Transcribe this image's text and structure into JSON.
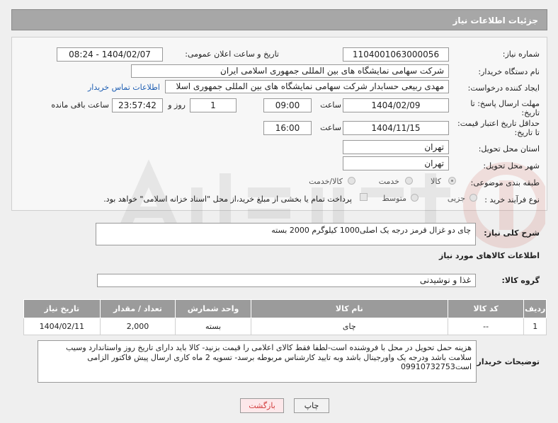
{
  "header": {
    "title": "جزئیات اطلاعات نیاز"
  },
  "form": {
    "need_number_label": "شماره نیاز:",
    "need_number": "1104001063000056",
    "announce_label": "تاریخ و ساعت اعلان عمومی:",
    "announce_value": "1404/02/07 - 08:24",
    "buyer_org_label": "نام دستگاه خریدار:",
    "buyer_org": "شرکت سهامی نمایشگاه های بین المللی جمهوری اسلامی ایران",
    "creator_label": "ایجاد کننده درخواست:",
    "creator": "مهدی  ربیعی حسابدار شرکت سهامی نمایشگاه های بین المللی جمهوری اسلا",
    "contact_link": "اطلاعات تماس خریدار",
    "reply_deadline_label_1": "مهلت ارسال پاسخ: تا",
    "reply_deadline_label_2": "تاریخ:",
    "reply_date": "1404/02/09",
    "time_label": "ساعت",
    "reply_time": "09:00",
    "days_value": "1",
    "days_label": "روز و",
    "remaining_time": "23:57:42",
    "remaining_label": "ساعت باقی مانده",
    "price_validity_label_1": "حداقل تاریخ اعتبار قیمت:",
    "price_validity_label_2": "تا تاریخ:",
    "validity_date": "1404/11/15",
    "validity_time": "16:00",
    "province_label": "استان محل تحویل:",
    "province": "تهران",
    "city_label": "شهر محل تحویل:",
    "city": "تهران",
    "category_label": "طبقه بندی موضوعی:",
    "category_options": [
      "کالا",
      "خدمت",
      "کالا/خدمت"
    ],
    "process_label": "نوع فرآیند خرید :",
    "process_options": [
      "جزیی",
      "متوسط"
    ],
    "payment_note": "پرداخت تمام یا بخشی از مبلغ خرید،از محل \"اسناد خزانه اسلامی\" خواهد بود."
  },
  "description": {
    "label": "شرح کلی نیاز:",
    "text": "چای دو غزال قرمز درجه یک اصلی1000 کیلوگرم 2000 بسته"
  },
  "goods_info": {
    "section_title": "اطلاعات کالاهای مورد نیاز",
    "group_label": "گروه کالا:",
    "group_value": "غذا و نوشیدنی"
  },
  "table": {
    "headers": [
      "ردیف",
      "کد کالا",
      "نام کالا",
      "واحد شمارش",
      "تعداد / مقدار",
      "تاریخ نیاز"
    ],
    "rows": [
      [
        "1",
        "--",
        "چای",
        "بسته",
        "2,000",
        "1404/02/11"
      ]
    ]
  },
  "buyer_notes": {
    "label": "توضیحات خریدار:",
    "text": "هزینه حمل تحویل در محل با فروشنده است-لطفا فقط کالای اعلامی را قیمت بزنید- کالا باید دارای تاریخ روز واستاندارد وسیب سلامت باشد ودرجه یک واورجینال باشد وبه تایید کارشناس مربوطه برسد- تسویه 2 ماه کاری ارسال پیش فاکتور الزامی است09910732753"
  },
  "buttons": {
    "print": "چاپ",
    "back": "بازگشت"
  },
  "colors": {
    "header_bg": "#a7a7a7",
    "table_header_bg": "#9b9b9b",
    "link": "#1f5fb3",
    "back_text": "#d23a3a"
  }
}
